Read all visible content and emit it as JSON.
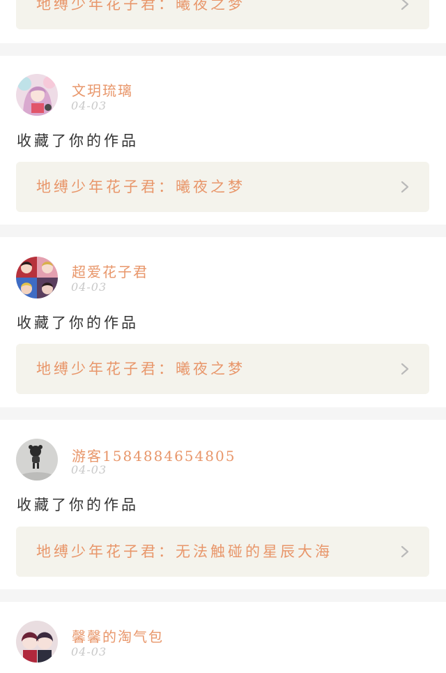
{
  "feed": {
    "items": [
      {
        "username": "",
        "date": "",
        "action": "",
        "work_title": "地缚少年花子君：曦夜之梦"
      },
      {
        "username": "文玥琉璃",
        "date": "04-03",
        "action": "收藏了你的作品",
        "work_title": "地缚少年花子君：曦夜之梦",
        "avatar_icon": "anime-girl-avatar"
      },
      {
        "username": "超爱花子君",
        "date": "04-03",
        "action": "收藏了你的作品",
        "work_title": "地缚少年花子君：曦夜之梦",
        "avatar_icon": "anime-collage-avatar"
      },
      {
        "username": "游客1584884654805",
        "date": "04-03",
        "action": "收藏了你的作品",
        "work_title": "地缚少年花子君：无法触碰的星辰大海",
        "avatar_icon": "figurine-avatar"
      },
      {
        "username": "馨馨的淘气包",
        "date": "04-03",
        "avatar_icon": "anime-duo-avatar"
      }
    ]
  },
  "colors": {
    "accent": "#e8966a",
    "link_bg": "#f4f3ec",
    "date": "#c9c9c9",
    "text": "#333333",
    "separator": "#f5f5f5"
  }
}
